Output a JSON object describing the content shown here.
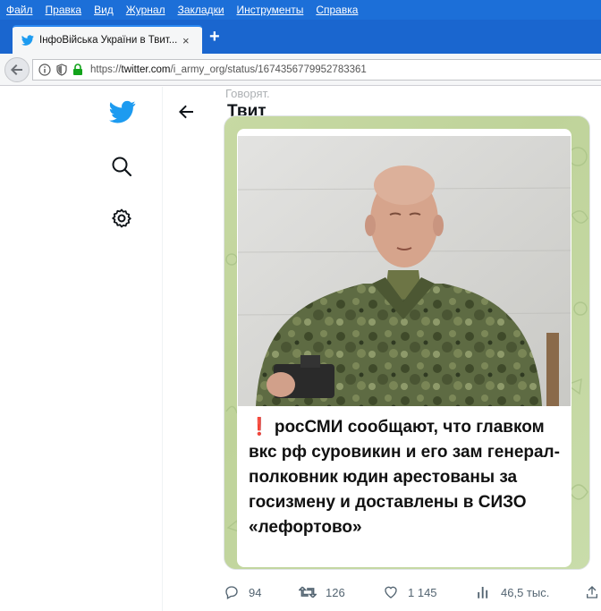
{
  "menu": [
    "Файл",
    "Правка",
    "Вид",
    "Журнал",
    "Закладки",
    "Инструменты",
    "Справка"
  ],
  "tab": {
    "title": "ІнфоВійська України в Твит...",
    "close": "×",
    "new_tab": "+"
  },
  "address": {
    "scheme": "https://",
    "host": "twitter.com",
    "path": "/i_army_org/status/1674356779952783361"
  },
  "header": {
    "title": "Твит",
    "ghost_text": "Говорят."
  },
  "tweet": {
    "caption": "❗ росСМИ сообщают, что главком вкс рф суровикин и его зам генерал-полковник юдин арестованы за госизмену и доставлены в СИЗО «лефортово»"
  },
  "actions": {
    "replies": "94",
    "retweets": "126",
    "likes": "1 145",
    "views": "46,5 тыс."
  },
  "colors": {
    "twitter_blue": "#1d9bf0",
    "firefox_blue": "#1c6fd8"
  }
}
